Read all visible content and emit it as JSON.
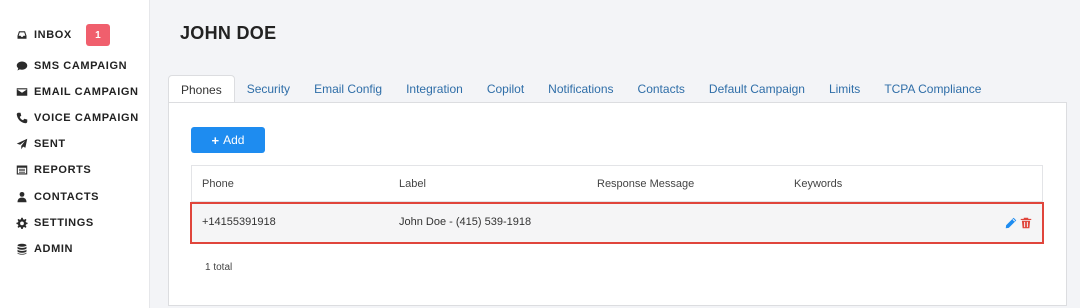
{
  "sidebar": {
    "items": [
      {
        "label": "INBOX",
        "icon": "inbox-icon",
        "badge": "1"
      },
      {
        "label": "SMS CAMPAIGN",
        "icon": "comment-icon"
      },
      {
        "label": "EMAIL CAMPAIGN",
        "icon": "envelope-icon"
      },
      {
        "label": "VOICE CAMPAIGN",
        "icon": "phone-icon"
      },
      {
        "label": "SENT",
        "icon": "paper-plane-icon"
      },
      {
        "label": "REPORTS",
        "icon": "list-alt-icon"
      },
      {
        "label": "CONTACTS",
        "icon": "user-icon"
      },
      {
        "label": "SETTINGS",
        "icon": "gear-icon"
      },
      {
        "label": "ADMIN",
        "icon": "database-icon"
      }
    ]
  },
  "header": {
    "title": "JOHN DOE"
  },
  "tabs": [
    {
      "label": "Phones",
      "active": true
    },
    {
      "label": "Security"
    },
    {
      "label": "Email Config"
    },
    {
      "label": "Integration"
    },
    {
      "label": "Copilot"
    },
    {
      "label": "Notifications"
    },
    {
      "label": "Contacts"
    },
    {
      "label": "Default Campaign"
    },
    {
      "label": "Limits"
    },
    {
      "label": "TCPA Compliance"
    }
  ],
  "toolbar": {
    "add_label": "Add"
  },
  "table": {
    "columns": [
      "Phone",
      "Label",
      "Response Message",
      "Keywords"
    ],
    "rows": [
      {
        "phone": "+14155391918",
        "label": "John Doe - (415) 539-1918",
        "response_message": "",
        "keywords": ""
      }
    ],
    "total": "1 total"
  },
  "colors": {
    "accent": "#1e8cf0",
    "badge": "#f05f6d",
    "highlight": "#e0453b",
    "edit_icon": "#1e8cf0",
    "delete_icon": "#e0453b"
  }
}
